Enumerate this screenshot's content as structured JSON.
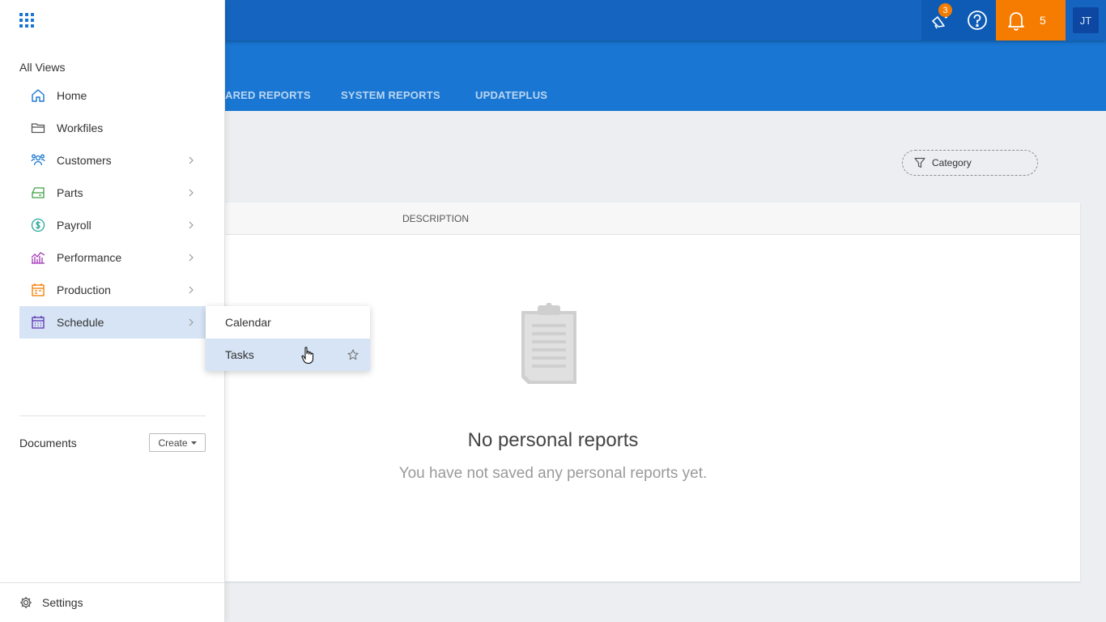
{
  "topbar": {
    "announcement_badge": "3",
    "notification_count": "5",
    "avatar_initials": "JT",
    "colors": {
      "primary": "#1565c0",
      "accent": "#f57c00"
    }
  },
  "tabs": [
    {
      "label": "ARED REPORTS"
    },
    {
      "label": "SYSTEM REPORTS"
    },
    {
      "label": "UPDATEPLUS"
    }
  ],
  "filter": {
    "category_label": "Category"
  },
  "table": {
    "columns": [
      "DESCRIPTION"
    ]
  },
  "empty_state": {
    "title": "No personal reports",
    "subtitle": "You have not saved any personal reports yet."
  },
  "sidenav": {
    "section_title": "All Views",
    "items": [
      {
        "label": "Home",
        "icon": "home-icon",
        "color": "#1976d2"
      },
      {
        "label": "Workfiles",
        "icon": "folder-icon",
        "color": "#555555"
      },
      {
        "label": "Customers",
        "icon": "customers-icon",
        "color": "#1976d2"
      },
      {
        "label": "Parts",
        "icon": "parts-icon",
        "color": "#43a047"
      },
      {
        "label": "Payroll",
        "icon": "dollar-icon",
        "color": "#26a69a"
      },
      {
        "label": "Performance",
        "icon": "performance-icon",
        "color": "#9c27b0"
      },
      {
        "label": "Production",
        "icon": "production-icon",
        "color": "#f57c00"
      },
      {
        "label": "Schedule",
        "icon": "calendar-icon",
        "color": "#5e35b1"
      }
    ],
    "documents_label": "Documents",
    "create_label": "Create",
    "settings_label": "Settings"
  },
  "flyout": {
    "items": [
      {
        "label": "Calendar"
      },
      {
        "label": "Tasks"
      }
    ]
  }
}
